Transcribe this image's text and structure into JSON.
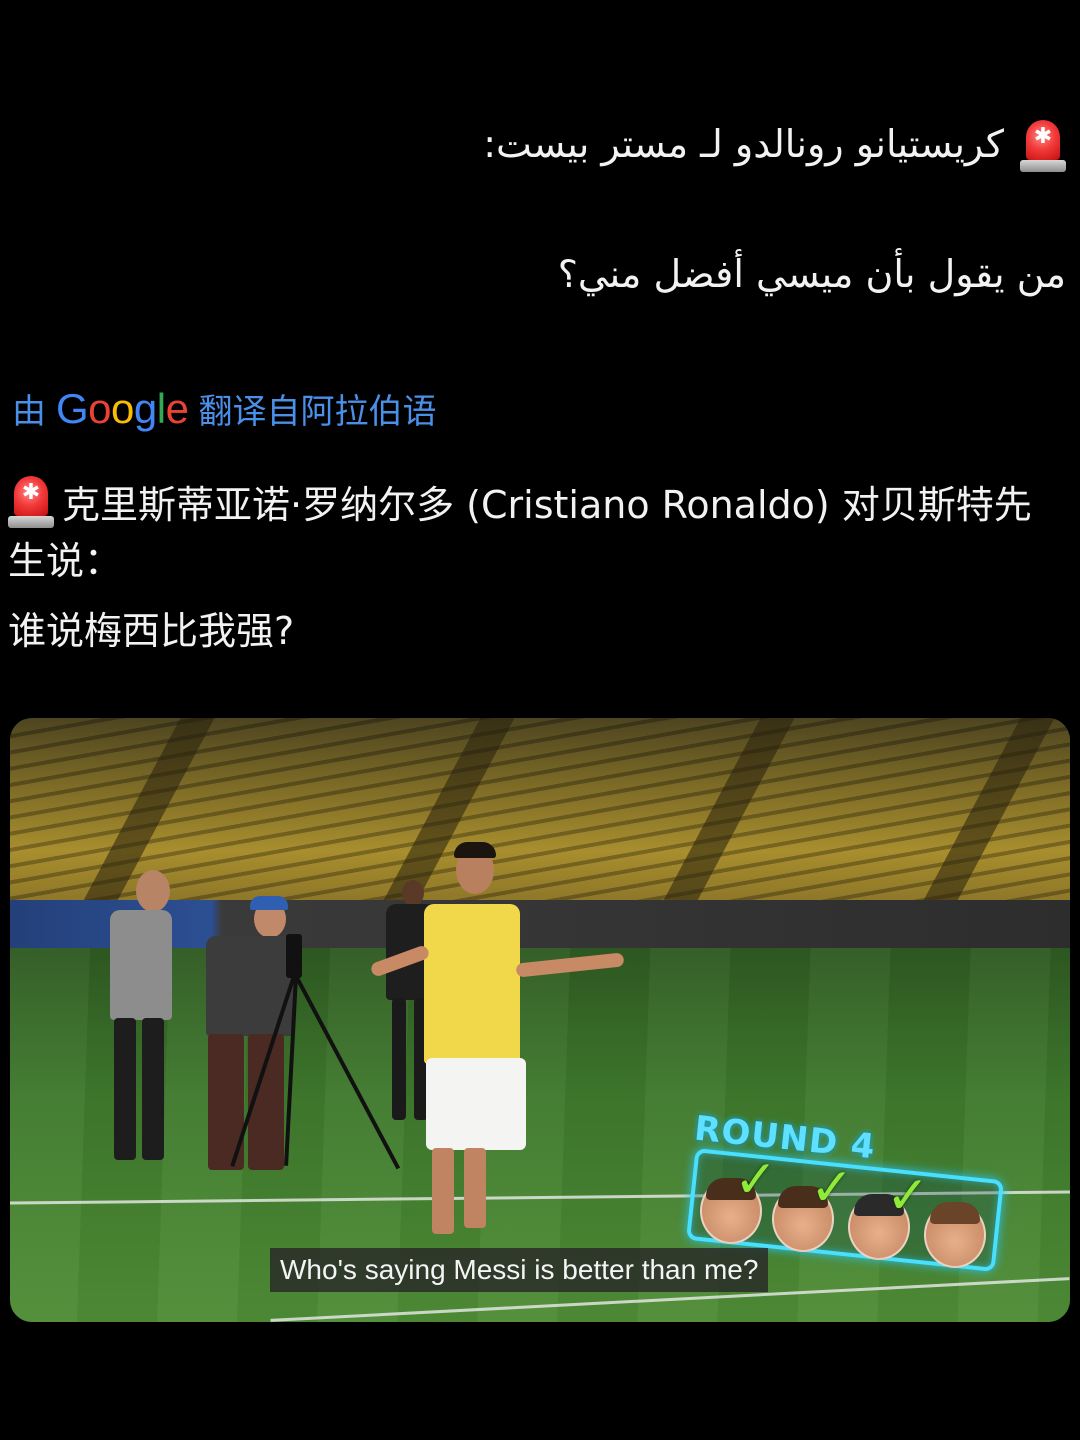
{
  "original": {
    "line1": "كريستيانو رونالدو لـ مستر بيست:",
    "line2": "من يقول بأن ميسي أفضل مني؟"
  },
  "translation": {
    "prefix": "由",
    "logo_text": "Google",
    "suffix": "翻译自阿拉伯语"
  },
  "translated": {
    "line1": "克里斯蒂亚诺·罗纳尔多 (Cristiano Ronaldo) 对贝斯特先生说：",
    "line2": "谁说梅西比我强?"
  },
  "media": {
    "overlay_title": "ROUND 4",
    "subtitle": "Who's saying Messi is better than me?"
  },
  "icons": {
    "siren": "police-siren-emoji-icon"
  },
  "colors": {
    "background": "#000000",
    "text": "#f2f2f2",
    "translation_link": "#4a8fe8",
    "hud_cyan": "#49e0ff",
    "check_green": "#8fea3a"
  }
}
